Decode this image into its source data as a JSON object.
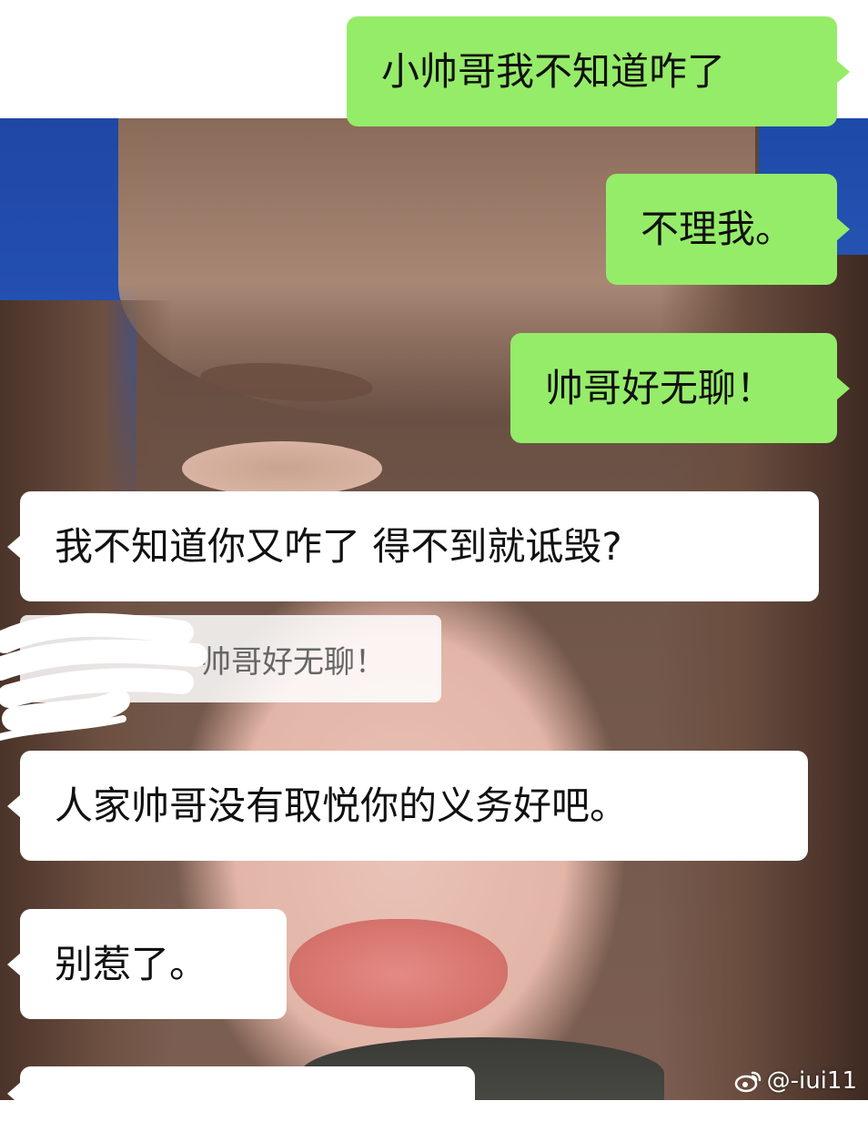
{
  "messages": [
    {
      "side": "sent",
      "text": "小帅哥我不知道咋了"
    },
    {
      "side": "sent",
      "text": "不理我。"
    },
    {
      "side": "sent",
      "text": "帅哥好无聊！"
    },
    {
      "side": "received",
      "text": "我不知道你又咋了 得不到就诋毁?"
    },
    {
      "side": "received",
      "text": "人家帅哥没有取悦你的义务好吧。"
    },
    {
      "side": "received",
      "text": "别惹了。"
    }
  ],
  "quoted_reply": {
    "text": "帅哥好无聊！"
  },
  "watermark": {
    "text": "@-iui11",
    "icon": "weibo-icon"
  },
  "colors": {
    "sent_bubble": "#95ec69",
    "received_bubble": "#ffffff",
    "page_background": "#ffffff"
  }
}
